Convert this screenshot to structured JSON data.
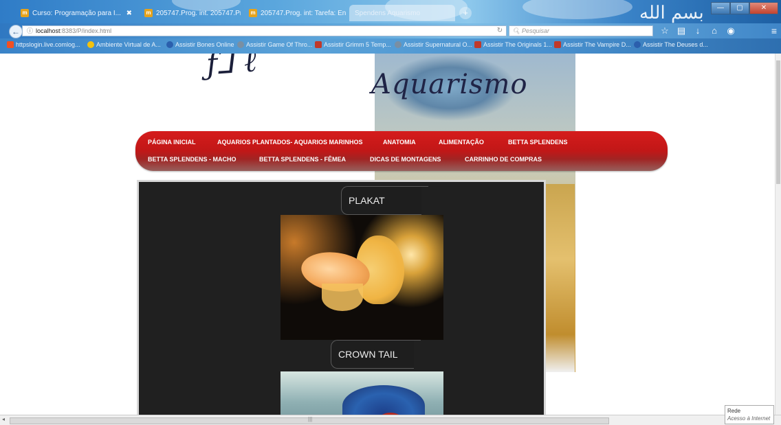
{
  "browser": {
    "tabs": [
      {
        "label": "Curso: Programação para I...",
        "active": false
      },
      {
        "label": "205747.Prog. int. 205747.Pr...",
        "active": false
      },
      {
        "label": "205747.Prog. int: Tarefa: En...",
        "active": false
      },
      {
        "label": "Spendens Aquarismo",
        "active": true
      }
    ],
    "url_host": "localhost",
    "url_path": ":8383/P/index.html",
    "search_placeholder": "Pesquisar",
    "bookmarks": [
      {
        "label": "httpslogin.live.comlog...",
        "color": "#f25022"
      },
      {
        "label": "Ambiente Virtual de A...",
        "color": "#f4c20d"
      },
      {
        "label": "Assistir Bones Online",
        "color": "#2b5fad"
      },
      {
        "label": "Assistir Game Of Thro...",
        "color": "#7a8fa3"
      },
      {
        "label": "Assistir Grimm 5 Temp...",
        "color": "#c0392b"
      },
      {
        "label": "Assistir Supernatural O...",
        "color": "#7a8fa3"
      },
      {
        "label": "Assistir The Originals 1...",
        "color": "#c0392b"
      },
      {
        "label": "Assistir The Vampire D...",
        "color": "#c0392b"
      },
      {
        "label": "Assistir The Deuses d...",
        "color": "#2b5fad"
      }
    ]
  },
  "site": {
    "logo_text": "Aquarismo",
    "menu": [
      "PÁGINA INICIAL",
      "AQUARIOS PLANTADOS- AQUARIOS MARINHOS",
      "ANATOMIA",
      "ALIMENTAÇÃO",
      "BETTA SPLENDENS",
      "BETTA SPLENDENS - MACHO",
      "BETTA SPLENDENS - FÊMEA",
      "DICAS DE MONTAGENS",
      "CARRINHO DE COMPRAS"
    ],
    "sections": [
      {
        "heading": "PLAKAT"
      },
      {
        "heading": "CROWN TAIL"
      }
    ]
  },
  "statusbar": {
    "title": "Rede",
    "subtitle": "Acesso à Internet"
  },
  "colors": {
    "menu_red": "#c11717",
    "content_bg": "#202020"
  }
}
